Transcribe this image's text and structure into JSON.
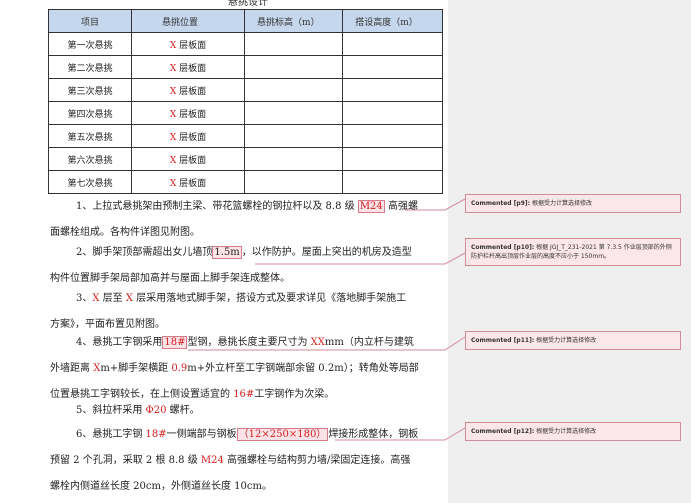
{
  "heading_cropped": "悬挑设计",
  "table": {
    "headers": [
      "项目",
      "悬挑位置",
      "悬挑标高（m）",
      "搭设高度（m）"
    ],
    "rows": [
      {
        "item": "第一次悬挑",
        "pos_x": "X",
        "pos_rest": " 层板面"
      },
      {
        "item": "第二次悬挑",
        "pos_x": "X",
        "pos_rest": " 层板面"
      },
      {
        "item": "第三次悬挑",
        "pos_x": "X",
        "pos_rest": " 层板面"
      },
      {
        "item": "第四次悬挑",
        "pos_x": "X",
        "pos_rest": " 层板面"
      },
      {
        "item": "第五次悬挑",
        "pos_x": "X",
        "pos_rest": " 层板面"
      },
      {
        "item": "第六次悬挑",
        "pos_x": "X",
        "pos_rest": " 层板面"
      },
      {
        "item": "第七次悬挑",
        "pos_x": "X",
        "pos_rest": " 层板面"
      }
    ]
  },
  "paragraphs": {
    "p1": {
      "a": "1、上拉式悬挑架由预制主梁、带花篮螺栓的钢拉杆以及 8.8 级 ",
      "mark": "M24",
      "b": " 高强螺",
      "c": "面螺栓组成。各构件详图见附图。"
    },
    "p2": {
      "a": "2、脚手架顶部需超出女儿墙顶",
      "mark": "1.5m",
      "b": "，以作防护。屋面上突出的机房及造型",
      "c": "构件位置脚手架局部加高并与屋面上脚手架连成整体。"
    },
    "p3": {
      "x1": "X",
      "a": " 层至 ",
      "x2": "X",
      "b": " 层采用落地式脚手架，搭设方式及要求详见《落地脚手架施工",
      "c": "方案》，平面布置见附图。",
      "num": "3、"
    },
    "p4": {
      "num": "4、悬挑工字钢采用",
      "mark": "18#",
      "a": "型钢，悬挑长度主要尺寸为 ",
      "xx": "XX",
      "b": "mm（内立杆与建筑",
      "c1": "外墙距离 ",
      "xm": "X",
      "c2": "m+脚手架横距 ",
      "v09": "0.9",
      "c3": "m+外立杆至工字钢端部余留 0.2m）；转角处等局部",
      "d1": "位置悬挑工字钢较长，在上侧设置适宜的 ",
      "d16": "16#",
      "d2": "工字钢作为次梁。"
    },
    "p5": {
      "a": "5、斜拉杆采用 ",
      "phi": "Φ20",
      "b": " 螺杆。"
    },
    "p6": {
      "a": "6、悬挑工字钢 ",
      "r18": "18#",
      "b": "一侧端部与钢板",
      "mark": "（12×250×180）",
      "c": "焊接形成整体，钢板",
      "d1": "预留 2 个孔洞，采取 2 根 8.8 级 ",
      "dm": "M24",
      "d2": " 高强螺栓与结构剪力墙/梁固定连接。高强",
      "e": "螺栓内侧道丝长度 20cm，外侧道丝长度 10cm。"
    }
  },
  "comments": [
    {
      "label": "Commented [p9]:",
      "text": " 根据受力计算选择修改"
    },
    {
      "label": "Commented [p10]:",
      "text": " 根据 JGJ_T_231-2021 第 7.3.5 作业层顶部的外侧防护栏杆高出顶层作业层的高度不应小于 150mm。"
    },
    {
      "label": "Commented [p11]:",
      "text": " 根据受力计算选择修改"
    },
    {
      "label": "Commented [p12]:",
      "text": " 根据受力计算选择修改"
    }
  ],
  "colors": {
    "header_fill": "#c5d7ec",
    "red_text": "#d32020",
    "comment_fill": "#fbe6ea",
    "comment_border": "#d28b98",
    "sidebar_bg": "#efefef"
  }
}
